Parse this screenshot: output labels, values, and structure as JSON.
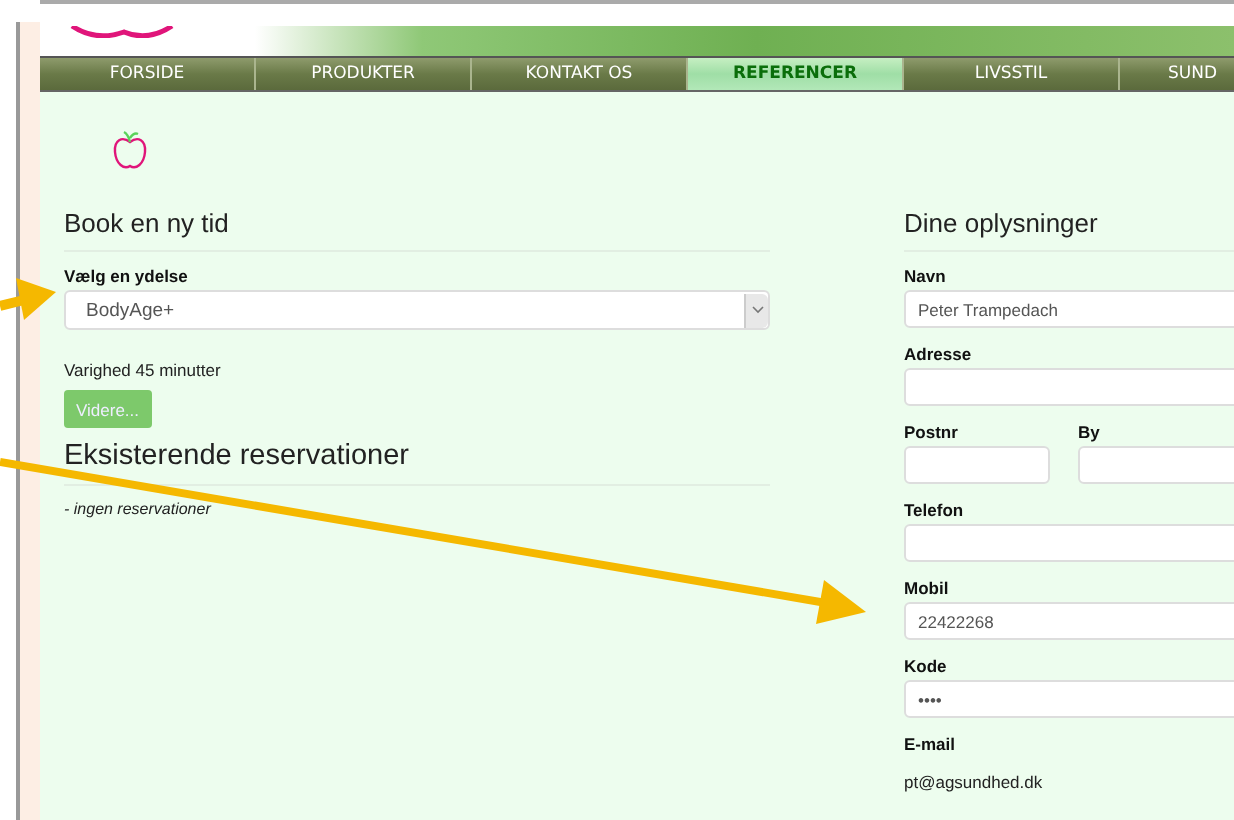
{
  "nav": {
    "tabs": [
      {
        "label": "FORSIDE",
        "selected": false
      },
      {
        "label": "PRODUKTER",
        "selected": false
      },
      {
        "label": "KONTAKT OS",
        "selected": false
      },
      {
        "label": "REFERENCER",
        "selected": true
      },
      {
        "label": "LIVSSTIL",
        "selected": false
      },
      {
        "label": "SUND",
        "selected": false
      }
    ]
  },
  "booking": {
    "heading": "Book en ny tid",
    "service_label": "Vælg en ydelse",
    "service_value": "BodyAge+",
    "duration": "Varighed 45 minutter",
    "continue_button": "Videre...",
    "reservations_heading": "Eksisterende reservationer",
    "reservations_empty": "- ingen reservationer"
  },
  "details": {
    "heading": "Dine oplysninger",
    "fields": [
      {
        "kind": "input",
        "label": "Navn",
        "value": "Peter Trampedach"
      },
      {
        "kind": "input",
        "label": "Adresse"
      },
      {
        "kind": "pair",
        "items": [
          {
            "label": "Postnr"
          },
          {
            "label": "By"
          }
        ]
      },
      {
        "kind": "input",
        "label": "Telefon"
      },
      {
        "kind": "input",
        "label": "Mobil",
        "value": "22422268"
      },
      {
        "kind": "input",
        "label": "Kode",
        "value": "••••"
      },
      {
        "kind": "static",
        "label": "E-mail",
        "value": "pt@agsundhed.dk"
      }
    ]
  }
}
